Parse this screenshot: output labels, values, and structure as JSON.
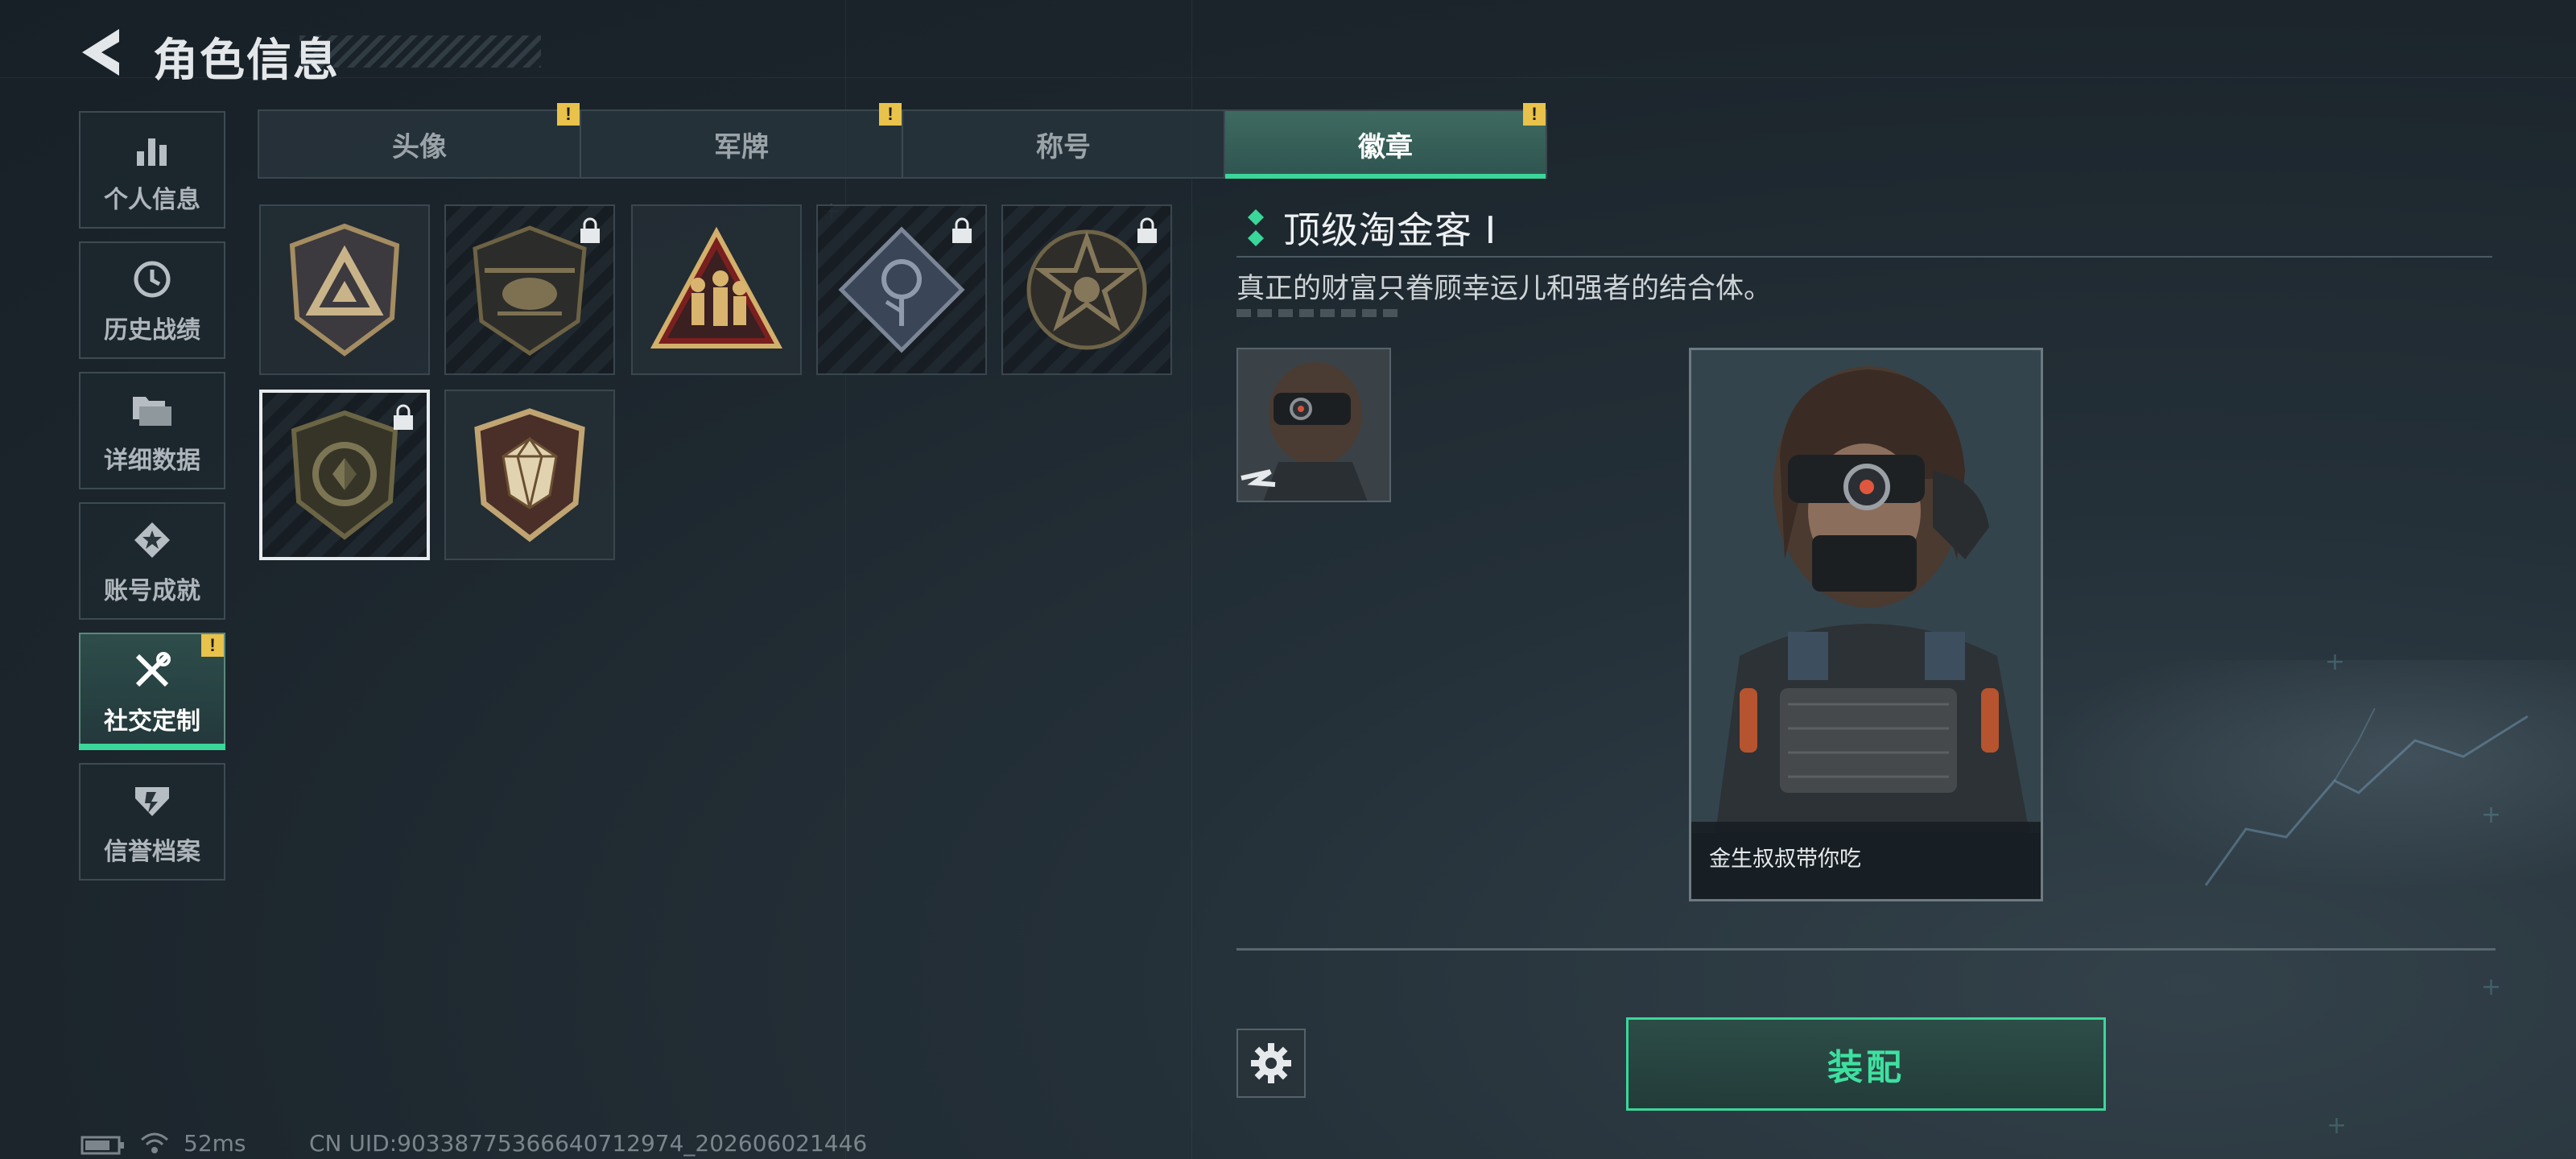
{
  "header": {
    "title": "角色信息",
    "back_icon": "back-arrow-icon"
  },
  "sidebar": {
    "items": [
      {
        "label": "个人信息",
        "icon": "bar-chart-icon",
        "active": false
      },
      {
        "label": "历史战绩",
        "icon": "history-clock-icon",
        "active": false
      },
      {
        "label": "详细数据",
        "icon": "folder-icon",
        "active": false
      },
      {
        "label": "账号成就",
        "icon": "achievement-star-icon",
        "active": false
      },
      {
        "label": "社交定制",
        "icon": "tools-icon",
        "active": true,
        "alert": "!"
      },
      {
        "label": "信誉档案",
        "icon": "credit-shield-icon",
        "active": false
      }
    ]
  },
  "tabs": [
    {
      "label": "头像",
      "alert": "!"
    },
    {
      "label": "军牌",
      "alert": "!"
    },
    {
      "label": "称号"
    },
    {
      "label": "徽章",
      "active": true,
      "alert": "!"
    }
  ],
  "badges": [
    {
      "name": "triangle-shield-badge",
      "locked": false
    },
    {
      "name": "helicopter-badge",
      "locked": true
    },
    {
      "name": "soldiers-triangle-badge",
      "locked": false
    },
    {
      "name": "rose-diamond-badge",
      "locked": true
    },
    {
      "name": "star-skull-badge",
      "locked": true
    },
    {
      "name": "circle-shield-badge",
      "locked": true,
      "selected": true
    },
    {
      "name": "gem-shield-badge",
      "locked": false
    }
  ],
  "detail": {
    "title": "顶级淘金客 Ⅰ",
    "description": "真正的财富只眷顾幸运儿和强者的结合体。",
    "card_caption": "金生叔叔带你吃"
  },
  "actions": {
    "equip_label": "装配",
    "settings_icon": "gear-icon"
  },
  "status_bar": {
    "ping": "52ms",
    "uid": "CN UID:90338775366640712974_202606021446"
  },
  "colors": {
    "accent": "#3ad79a",
    "alert": "#e8c24a"
  }
}
